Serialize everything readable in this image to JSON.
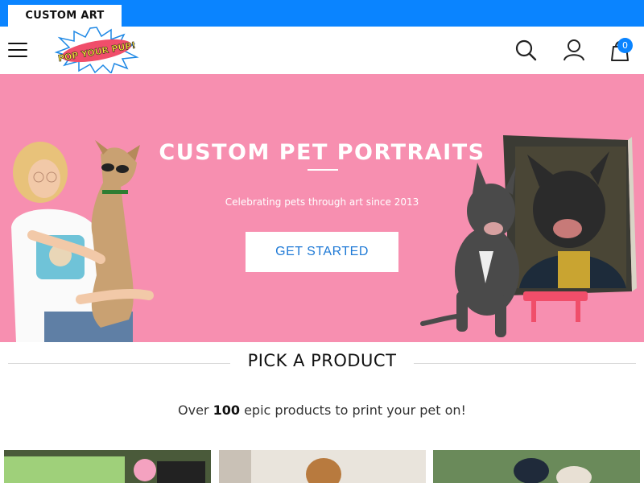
{
  "top_strip": {
    "tab_label": "CUSTOM ART"
  },
  "header": {
    "logo_text": "POP YOUR PUP!",
    "cart_count": "0",
    "icons": [
      "menu-icon",
      "search-icon",
      "account-icon",
      "cart-icon"
    ]
  },
  "hero": {
    "title": "CUSTOM PET PORTRAITS",
    "subtitle": "Celebrating pets through art since 2013",
    "cta_label": "GET STARTED",
    "background_color": "#f78fb0"
  },
  "products_section": {
    "title": "PICK A PRODUCT",
    "tagline_prefix": "Over ",
    "tagline_count": "100",
    "tagline_suffix": " epic products to print your pet on!"
  },
  "colors": {
    "accent": "#0a84ff",
    "cta_text": "#1f7ad6"
  }
}
